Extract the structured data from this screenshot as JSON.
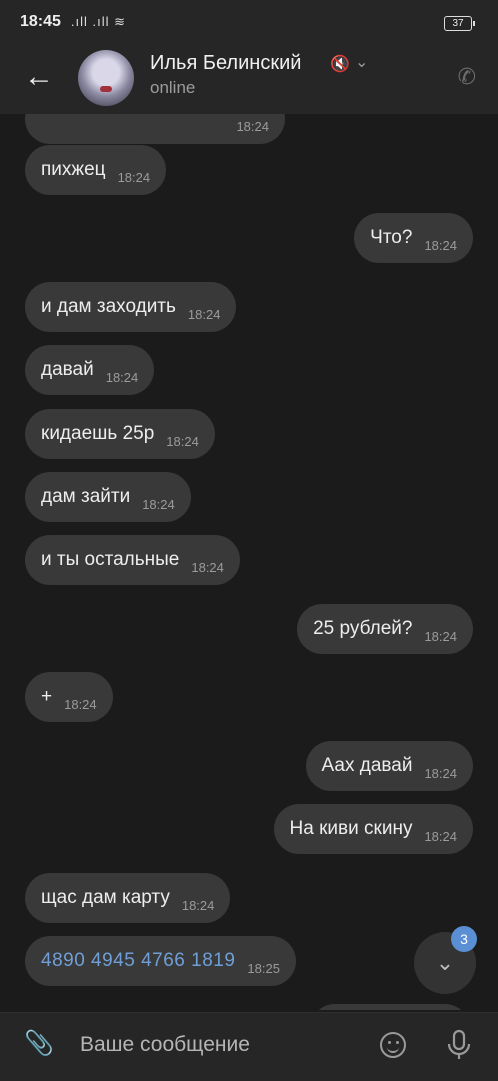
{
  "status_bar": {
    "time": "18:45",
    "signal": ".ıll .ıll ≋",
    "battery": "37"
  },
  "header": {
    "name": "Илья Белинский",
    "status": "online"
  },
  "messages": [
    {
      "text": "",
      "time": "18:24",
      "side": "in"
    },
    {
      "text": "пихжец",
      "time": "18:24",
      "side": "in"
    },
    {
      "text": "Что?",
      "time": "18:24",
      "side": "out"
    },
    {
      "text": "и дам заходить",
      "time": "18:24",
      "side": "in"
    },
    {
      "text": "давай",
      "time": "18:24",
      "side": "in"
    },
    {
      "text": "кидаешь 25р",
      "time": "18:24",
      "side": "in"
    },
    {
      "text": "дам зайти",
      "time": "18:24",
      "side": "in"
    },
    {
      "text": "и ты остальные",
      "time": "18:24",
      "side": "in"
    },
    {
      "text": "25 рублей?",
      "time": "18:24",
      "side": "out"
    },
    {
      "text": "+",
      "time": "18:24",
      "side": "in"
    },
    {
      "text": "Аах давай",
      "time": "18:24",
      "side": "out"
    },
    {
      "text": "На киви скину",
      "time": "18:24",
      "side": "out"
    },
    {
      "text": "щас дам карту",
      "time": "18:24",
      "side": "in"
    },
    {
      "text": "4890 4945 4766 1819",
      "time": "18:25",
      "side": "in",
      "link": true
    }
  ],
  "scroll_badge": "3",
  "input": {
    "placeholder": "Ваше сообщение"
  },
  "colors": {
    "background": "#1b1b1b",
    "bubble": "#393939",
    "bar": "#262626",
    "link": "#6f9fd6",
    "badge": "#5a8fd4"
  }
}
